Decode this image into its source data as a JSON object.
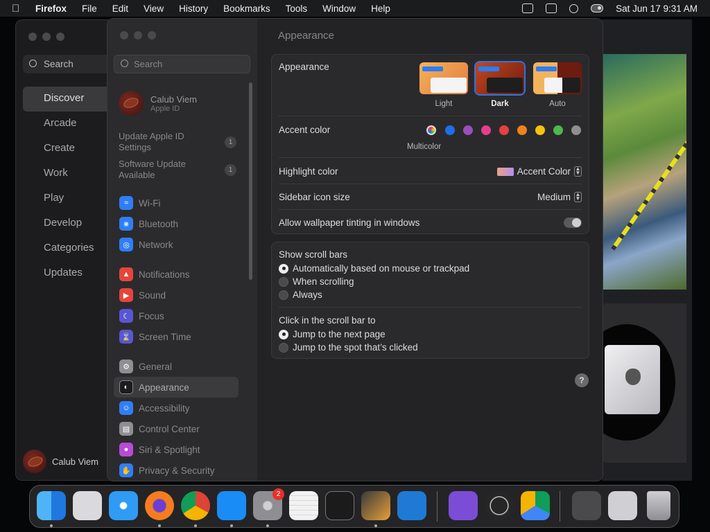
{
  "menubar": {
    "app_name": "Firefox",
    "menus": [
      "File",
      "Edit",
      "View",
      "History",
      "Bookmarks",
      "Tools",
      "Window",
      "Help"
    ],
    "clock": "Sat Jun 17  9:31 AM"
  },
  "appstore": {
    "search_placeholder": "Search",
    "nav": [
      "Discover",
      "Arcade",
      "Create",
      "Work",
      "Play",
      "Develop",
      "Categories",
      "Updates"
    ],
    "user_name": "Calub Viem"
  },
  "settings": {
    "search_placeholder": "Search",
    "profile": {
      "name": "Calub Viem",
      "subtitle": "Apple ID"
    },
    "notices": [
      {
        "label": "Update Apple ID Settings",
        "badge": "1"
      },
      {
        "label": "Software Update Available",
        "badge": "1"
      }
    ],
    "groups": [
      [
        {
          "label": "Wi-Fi",
          "icon": "wifi-icon",
          "color": "#2f7ef5"
        },
        {
          "label": "Bluetooth",
          "icon": "bluetooth-icon",
          "color": "#2f7ef5"
        },
        {
          "label": "Network",
          "icon": "globe-icon",
          "color": "#2f7ef5"
        }
      ],
      [
        {
          "label": "Notifications",
          "icon": "bell-icon",
          "color": "#e5453b"
        },
        {
          "label": "Sound",
          "icon": "speaker-icon",
          "color": "#e5453b"
        },
        {
          "label": "Focus",
          "icon": "moon-icon",
          "color": "#5856d6"
        },
        {
          "label": "Screen Time",
          "icon": "hourglass-icon",
          "color": "#5856d6"
        }
      ],
      [
        {
          "label": "General",
          "icon": "gear-icon",
          "color": "#8e8e93"
        },
        {
          "label": "Appearance",
          "icon": "appearance-icon",
          "color": "#1c1c1e"
        },
        {
          "label": "Accessibility",
          "icon": "accessibility-icon",
          "color": "#2f7ef5"
        },
        {
          "label": "Control Center",
          "icon": "control-center-icon",
          "color": "#8e8e93"
        },
        {
          "label": "Siri & Spotlight",
          "icon": "siri-icon",
          "color": "#b84bd8"
        },
        {
          "label": "Privacy & Security",
          "icon": "hand-icon",
          "color": "#2f7ef5"
        }
      ]
    ],
    "pane": {
      "title": "Appearance",
      "appearance_label": "Appearance",
      "modes": [
        "Light",
        "Dark",
        "Auto"
      ],
      "selected_mode": "Dark",
      "accent_label": "Accent color",
      "accent_colors": [
        "multicolor",
        "#1e6fe8",
        "#9b4dbb",
        "#e23f8e",
        "#e84040",
        "#f0821e",
        "#f5c20c",
        "#4cb94c",
        "#8e8e93"
      ],
      "accent_selected_name": "Multicolor",
      "highlight_label": "Highlight color",
      "highlight_value": "Accent Color",
      "sidebar_icon_label": "Sidebar icon size",
      "sidebar_icon_value": "Medium",
      "tinting_label": "Allow wallpaper tinting in windows",
      "tinting_on": true,
      "scrollbars_label": "Show scroll bars",
      "scrollbar_options": [
        "Automatically based on mouse or trackpad",
        "When scrolling",
        "Always"
      ],
      "scrollbar_selected": 0,
      "click_label": "Click in the scroll bar to",
      "click_options": [
        "Jump to the next page",
        "Jump to the spot that’s clicked"
      ],
      "click_selected": 0,
      "help": "?"
    }
  },
  "dock": {
    "apps": [
      {
        "name": "finder-icon",
        "color": "#3aa0f0"
      },
      {
        "name": "launchpad-icon",
        "color": "#d9d9de"
      },
      {
        "name": "safari-icon",
        "color": "#2f9bf5"
      },
      {
        "name": "firefox-icon",
        "color": "#f57c1f"
      },
      {
        "name": "chrome-icon",
        "color": "#ffffff"
      },
      {
        "name": "app-store-icon",
        "color": "#1a8cf5"
      },
      {
        "name": "system-settings-icon",
        "color": "#8e8e93"
      },
      {
        "name": "textedit-icon",
        "color": "#f2f2f2"
      },
      {
        "name": "terminal-icon",
        "color": "#1b1b1b"
      },
      {
        "name": "garageband-icon",
        "color": "#3a3a3a"
      },
      {
        "name": "vscode-icon",
        "color": "#1f7ad6"
      },
      {
        "name": "visual-studio-icon",
        "color": "#7b4dd6"
      },
      {
        "name": "obs-icon",
        "color": "#262626"
      },
      {
        "name": "google-drive-icon",
        "color": "#ffffff"
      },
      {
        "name": "minimized-window-1",
        "color": "#4a4a4c"
      },
      {
        "name": "minimized-window-2",
        "color": "#d0d0d4"
      },
      {
        "name": "trash-icon",
        "color": "#b8b8bc"
      }
    ],
    "settings_badge": "2"
  }
}
